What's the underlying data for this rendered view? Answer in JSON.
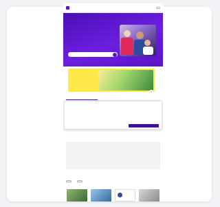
{
  "header": {
    "brand": "",
    "nav_links": [
      "",
      "",
      ""
    ]
  },
  "hero": {
    "title_plain": "",
    "title_highlight": "",
    "title_rest": "",
    "description": "",
    "search_placeholder": ""
  },
  "banner": {
    "text": "",
    "close_symbol": "×"
  },
  "tabs": [
    "",
    "",
    ""
  ],
  "cookie": {
    "title": "",
    "text": "",
    "settings_label": "",
    "accept_label": ""
  },
  "features": [
    {
      "flag": "",
      "text": ""
    },
    {
      "flag": "",
      "text": ""
    },
    {
      "flag": "",
      "text": ""
    },
    {
      "flag": "",
      "text": ""
    }
  ],
  "section": {
    "title": "",
    "pills": [
      "",
      ""
    ],
    "filter_label": ""
  },
  "colors": {
    "brand": "#5b14c9",
    "accent": "#ffd22e",
    "banner": "#ffe84a",
    "alert": "#d42b5d"
  }
}
